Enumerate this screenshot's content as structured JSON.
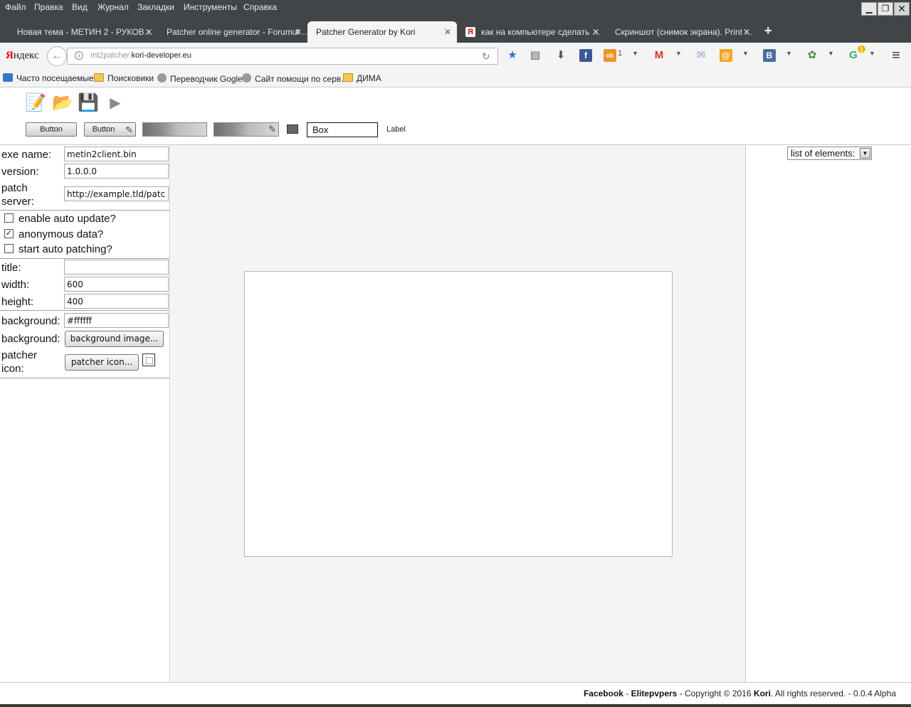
{
  "menu": [
    "Файл",
    "Правка",
    "Вид",
    "Журнал",
    "Закладки",
    "Инструменты",
    "Справка"
  ],
  "window_controls": {
    "minimize": "▁",
    "restore": "❐",
    "close": "✕"
  },
  "tabs": [
    {
      "title": "Новая тема - МЕТИН 2 - РУКОВ…",
      "active": false
    },
    {
      "title": "Patcher online generator - Forumul …",
      "active": false
    },
    {
      "title": "Patcher Generator by Kori",
      "active": true
    },
    {
      "title": "как на компьютере сделать …",
      "active": false
    },
    {
      "title": "Скриншот (снимок экрана). Print …",
      "active": false
    }
  ],
  "tab_close": "✕",
  "yandex_favicon": "Я",
  "newtab": "+",
  "nav": {
    "brand_first": "Я",
    "brand_rest": "ндекс",
    "back": "←",
    "info": "i",
    "url_prefix": "mt2patcher.",
    "url_domain": "kori-developer.eu",
    "reload": "↻"
  },
  "toolbar_icons": [
    {
      "name": "bookmark-star-icon",
      "glyph": "★",
      "color": "#2f6fd6"
    },
    {
      "name": "reader-list-icon",
      "glyph": "▤",
      "color": "#555555"
    },
    {
      "name": "download-icon",
      "glyph": "⬇",
      "color": "#555555"
    },
    {
      "name": "facebook-icon",
      "glyph": "f",
      "color": "#3b5998"
    },
    {
      "name": "odnoklassniki-icon",
      "glyph": "ok",
      "color": "#f0922b"
    },
    {
      "name": "gmail-icon",
      "glyph": "M",
      "color": "#d93025"
    },
    {
      "name": "mail-icon",
      "glyph": "✉",
      "color": "#8aa6c9"
    },
    {
      "name": "mailru-icon",
      "glyph": "@",
      "color": "#f5a623"
    },
    {
      "name": "vkontakte-icon",
      "glyph": "В",
      "color": "#4a6e9e"
    },
    {
      "name": "extension-puzzle-icon",
      "glyph": "✿",
      "color": "#3e8e3e"
    },
    {
      "name": "grammarly-icon",
      "glyph": "G",
      "color": "#33b36b"
    },
    {
      "name": "hamburger-menu-icon",
      "glyph": "≡",
      "color": "#333333"
    }
  ],
  "ok_count": "1",
  "badge_count": "1",
  "bookmarks": [
    {
      "label": "Часто посещаемые",
      "icon": "star-bm"
    },
    {
      "label": "Поисковики",
      "icon": "folder"
    },
    {
      "label": "Переводчик Gogle",
      "icon": "globe"
    },
    {
      "label": "Сайт помощи по серв…",
      "icon": "globe"
    },
    {
      "label": "ДИМА",
      "icon": "folder"
    }
  ],
  "app_toolbar": {
    "tools": [
      {
        "name": "new-document-icon",
        "glyph": "📝"
      },
      {
        "name": "open-folder-icon",
        "glyph": "📂"
      },
      {
        "name": "save-icon",
        "glyph": "💾"
      },
      {
        "name": "run-play-icon",
        "glyph": "▶"
      }
    ],
    "button_label": "Button",
    "button_edit_label": "Button",
    "pencil": "✎",
    "box_label": "Box",
    "label_text": "Label"
  },
  "form": {
    "exe_name_label": "exe name:",
    "exe_name_value": "metin2client.bin",
    "version_label": "version:",
    "version_value": "1.0.0.0",
    "patch_server_label_1": "patch",
    "patch_server_label_2": "server:",
    "patch_server_value": "http://example.tld/patcher/",
    "enable_auto_update_label": "enable auto update?",
    "enable_auto_update_checked": "",
    "anonymous_data_label": "anonymous data?",
    "anonymous_data_checked": "✓",
    "start_auto_patching_label": "start auto patching?",
    "start_auto_patching_checked": "",
    "title_label": "title:",
    "title_value": "",
    "width_label": "width:",
    "width_value": "600",
    "height_label": "height:",
    "height_value": "400",
    "background_color_label": "background:",
    "background_color_value": "#ffffff",
    "background_image_label": "background:",
    "background_image_button": "background image...",
    "patcher_icon_label_1": "patcher",
    "patcher_icon_label_2": "icon:",
    "patcher_icon_button": "patcher icon..."
  },
  "elements_select": {
    "value": "list of elements:",
    "arrow": "▼"
  },
  "footer": {
    "facebook": "Facebook",
    "dash1": " - ",
    "elitepvpers": "Elitepvpers",
    "copyright": " - Copyright © 2016 ",
    "kori": "Kori",
    "rights": ". All rights reserved. - 0.0.4 Alpha"
  }
}
